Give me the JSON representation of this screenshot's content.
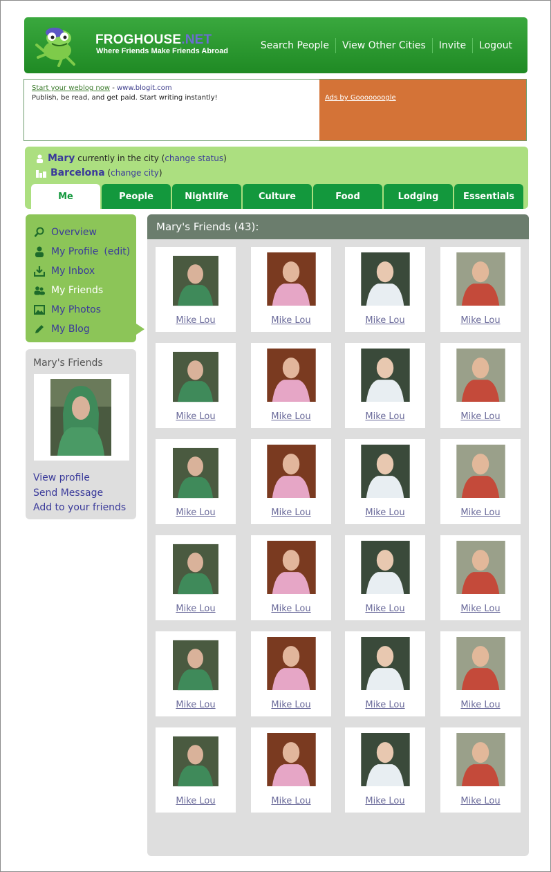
{
  "brand": {
    "title_main": "FROGHOUSE",
    "title_suffix": ".NET",
    "tagline": "Where Friends Make Friends Abroad"
  },
  "topnav": [
    "Search People",
    "View Other Cities",
    "Invite",
    "Logout"
  ],
  "ad": {
    "link_text": "Start your weblog now",
    "sep": " - ",
    "url": "www.blogit.com",
    "body": "Publish, be read, and get paid. Start writing instantly!",
    "ads_by": "Ads by Gooooooogle"
  },
  "status": {
    "user": "Mary",
    "in_city_text": "currently in the city",
    "change_status": "change status",
    "city": "Barcelona",
    "change_city": "change city",
    "open_paren": "(",
    "close_paren": ")"
  },
  "tabs": [
    "Me",
    "People",
    "Nightlife",
    "Culture",
    "Food",
    "Lodging",
    "Essentials"
  ],
  "active_tab": "Me",
  "leftnav": {
    "items": [
      {
        "label": "Overview",
        "icon": "search-icon"
      },
      {
        "label": "My Profile",
        "icon": "person-icon",
        "extra": "edit"
      },
      {
        "label": "My Inbox",
        "icon": "inbox-icon"
      },
      {
        "label": "My Friends",
        "icon": "friends-icon"
      },
      {
        "label": "My Photos",
        "icon": "photo-icon"
      },
      {
        "label": "My Blog",
        "icon": "pencil-icon"
      }
    ],
    "current": "My Friends"
  },
  "minibox": {
    "title": "Mary's Friends",
    "links": [
      "View profile",
      "Send Message",
      "Add to your friends"
    ]
  },
  "main": {
    "heading": "Mary's Friends (43):",
    "friend_name": "Mike Lou"
  },
  "colors": {
    "brand_green": "#1f8a24",
    "tab_green": "#13983d",
    "status_bg": "#acdf80",
    "leftnav_bg": "#8cc558",
    "ad_orange": "#d47337",
    "panel_header": "#6b7d6d",
    "link_blue": "#3a3a9a"
  }
}
